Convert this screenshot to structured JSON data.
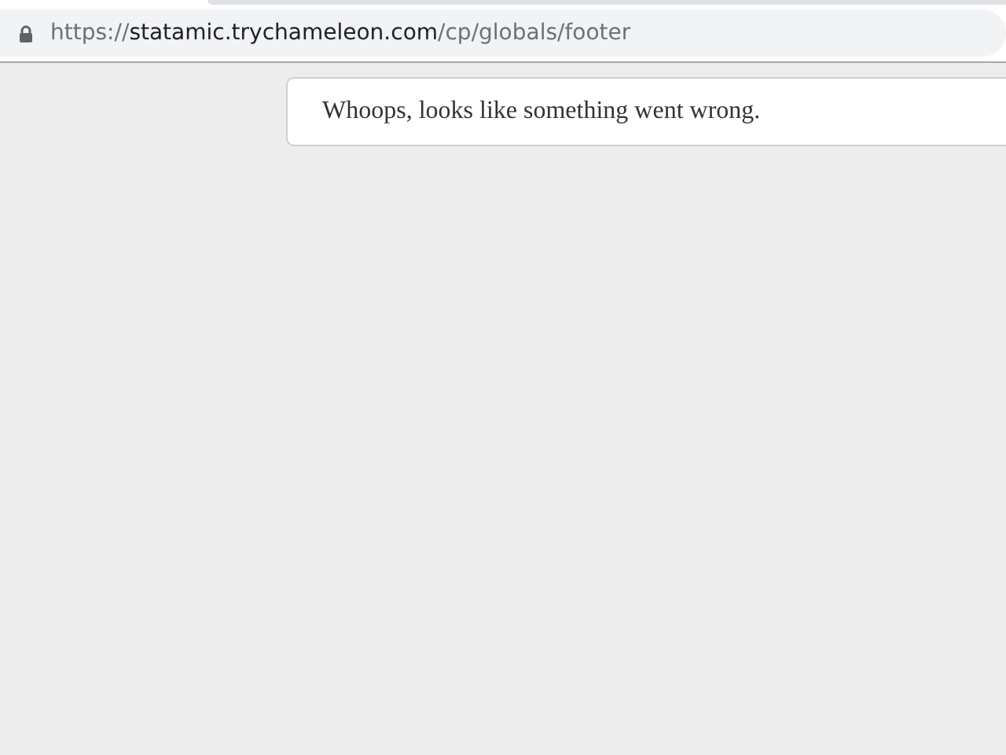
{
  "address_bar": {
    "scheme": "https://",
    "host": "statamic.trychameleon.com",
    "path": "/cp/globals/footer",
    "secure": true
  },
  "error_message": "Whoops, looks like something went wrong."
}
